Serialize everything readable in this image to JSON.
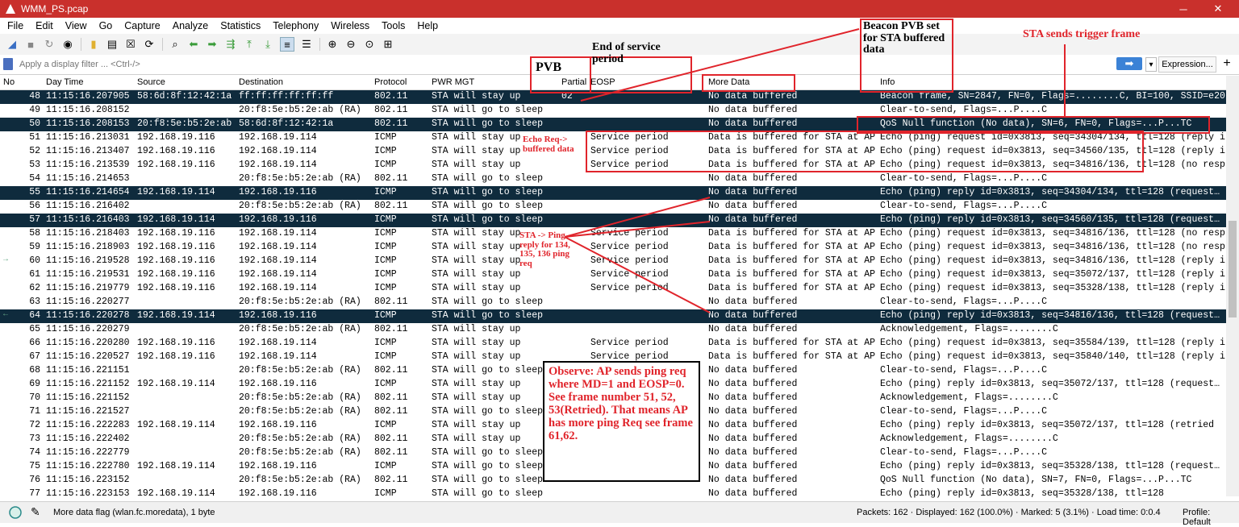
{
  "window": {
    "title": "WMM_PS.pcap"
  },
  "menu": [
    "File",
    "Edit",
    "View",
    "Go",
    "Capture",
    "Analyze",
    "Statistics",
    "Telephony",
    "Wireless",
    "Tools",
    "Help"
  ],
  "filter": {
    "placeholder": "Apply a display filter ... <Ctrl-/>",
    "expression_label": "Expression...",
    "plus": "+"
  },
  "columns": {
    "no": "No",
    "time": "Day Time",
    "source": "Source",
    "destination": "Destination",
    "protocol": "Protocol",
    "pwr": "PWR MGT",
    "partial": "Partial",
    "eosp": "EOSP",
    "more": "More Data",
    "info": "Info"
  },
  "packets": [
    {
      "no": "48",
      "time": "11:15:16.207905",
      "src": "58:6d:8f:12:42:1a",
      "dst": "ff:ff:ff:ff:ff:ff",
      "proto": "802.11",
      "pwr": "STA will stay up",
      "part": "02",
      "eosp": "",
      "more": "No data buffered",
      "info": "Beacon frame, SN=2847, FN=0, Flags=........C, BI=100, SSID=e200…",
      "sel": true
    },
    {
      "no": "49",
      "time": "11:15:16.208152",
      "src": "",
      "dst": "20:f8:5e:b5:2e:ab (RA)",
      "proto": "802.11",
      "pwr": "STA will go to sleep",
      "part": "",
      "eosp": "",
      "more": "No data buffered",
      "info": "Clear-to-send, Flags=...P....C"
    },
    {
      "no": "50",
      "time": "11:15:16.208153",
      "src": "20:f8:5e:b5:2e:ab",
      "dst": "58:6d:8f:12:42:1a",
      "proto": "802.11",
      "pwr": "STA will go to sleep",
      "part": "",
      "eosp": "",
      "more": "No data buffered",
      "info": "QoS Null function (No data), SN=6, FN=0, Flags=...P...TC",
      "sel": true
    },
    {
      "no": "51",
      "time": "11:15:16.213031",
      "src": "192.168.19.116",
      "dst": "192.168.19.114",
      "proto": "ICMP",
      "pwr": "STA will stay up",
      "part": "",
      "eosp": "Service period",
      "more": "Data is buffered for STA at AP",
      "info": "Echo (ping) request  id=0x3813, seq=34304/134, ttl=128 (reply i…"
    },
    {
      "no": "52",
      "time": "11:15:16.213407",
      "src": "192.168.19.116",
      "dst": "192.168.19.114",
      "proto": "ICMP",
      "pwr": "STA will stay up",
      "part": "",
      "eosp": "Service period",
      "more": "Data is buffered for STA at AP",
      "info": "Echo (ping) request  id=0x3813, seq=34560/135, ttl=128 (reply i…"
    },
    {
      "no": "53",
      "time": "11:15:16.213539",
      "src": "192.168.19.116",
      "dst": "192.168.19.114",
      "proto": "ICMP",
      "pwr": "STA will stay up",
      "part": "",
      "eosp": "Service period",
      "more": "Data is buffered for STA at AP",
      "info": "Echo (ping) request  id=0x3813, seq=34816/136, ttl=128 (no resp…"
    },
    {
      "no": "54",
      "time": "11:15:16.214653",
      "src": "",
      "dst": "20:f8:5e:b5:2e:ab (RA)",
      "proto": "802.11",
      "pwr": "STA will go to sleep",
      "part": "",
      "eosp": "",
      "more": "No data buffered",
      "info": "Clear-to-send, Flags=...P....C"
    },
    {
      "no": "55",
      "time": "11:15:16.214654",
      "src": "192.168.19.114",
      "dst": "192.168.19.116",
      "proto": "ICMP",
      "pwr": "STA will go to sleep",
      "part": "",
      "eosp": "",
      "more": "No data buffered",
      "info": "Echo (ping) reply    id=0x3813, seq=34304/134, ttl=128 (request…",
      "sel": true
    },
    {
      "no": "56",
      "time": "11:15:16.216402",
      "src": "",
      "dst": "20:f8:5e:b5:2e:ab (RA)",
      "proto": "802.11",
      "pwr": "STA will go to sleep",
      "part": "",
      "eosp": "",
      "more": "No data buffered",
      "info": "Clear-to-send, Flags=...P....C"
    },
    {
      "no": "57",
      "time": "11:15:16.216403",
      "src": "192.168.19.114",
      "dst": "192.168.19.116",
      "proto": "ICMP",
      "pwr": "STA will go to sleep",
      "part": "",
      "eosp": "",
      "more": "No data buffered",
      "info": "Echo (ping) reply    id=0x3813, seq=34560/135, ttl=128 (request…",
      "sel": true
    },
    {
      "no": "58",
      "time": "11:15:16.218403",
      "src": "192.168.19.116",
      "dst": "192.168.19.114",
      "proto": "ICMP",
      "pwr": "STA will stay up",
      "part": "",
      "eosp": "Service period",
      "more": "Data is buffered for STA at AP",
      "info": "Echo (ping) request  id=0x3813, seq=34816/136, ttl=128 (no resp…"
    },
    {
      "no": "59",
      "time": "11:15:16.218903",
      "src": "192.168.19.116",
      "dst": "192.168.19.114",
      "proto": "ICMP",
      "pwr": "STA will stay up",
      "part": "",
      "eosp": "Service period",
      "more": "Data is buffered for STA at AP",
      "info": "Echo (ping) request  id=0x3813, seq=34816/136, ttl=128 (no resp…"
    },
    {
      "no": "60",
      "time": "11:15:16.219528",
      "src": "192.168.19.116",
      "dst": "192.168.19.114",
      "proto": "ICMP",
      "pwr": "STA will stay up",
      "part": "",
      "eosp": "Service period",
      "more": "Data is buffered for STA at AP",
      "info": "Echo (ping) request  id=0x3813, seq=34816/136, ttl=128 (reply i…",
      "mark": "→"
    },
    {
      "no": "61",
      "time": "11:15:16.219531",
      "src": "192.168.19.116",
      "dst": "192.168.19.114",
      "proto": "ICMP",
      "pwr": "STA will stay up",
      "part": "",
      "eosp": "Service period",
      "more": "Data is buffered for STA at AP",
      "info": "Echo (ping) request  id=0x3813, seq=35072/137, ttl=128 (reply i…"
    },
    {
      "no": "62",
      "time": "11:15:16.219779",
      "src": "192.168.19.116",
      "dst": "192.168.19.114",
      "proto": "ICMP",
      "pwr": "STA will stay up",
      "part": "",
      "eosp": "Service period",
      "more": "Data is buffered for STA at AP",
      "info": "Echo (ping) request  id=0x3813, seq=35328/138, ttl=128 (reply i…"
    },
    {
      "no": "63",
      "time": "11:15:16.220277",
      "src": "",
      "dst": "20:f8:5e:b5:2e:ab (RA)",
      "proto": "802.11",
      "pwr": "STA will go to sleep",
      "part": "",
      "eosp": "",
      "more": "No data buffered",
      "info": "Clear-to-send, Flags=...P....C"
    },
    {
      "no": "64",
      "time": "11:15:16.220278",
      "src": "192.168.19.114",
      "dst": "192.168.19.116",
      "proto": "ICMP",
      "pwr": "STA will go to sleep",
      "part": "",
      "eosp": "",
      "more": "No data buffered",
      "info": "Echo (ping) reply    id=0x3813, seq=34816/136, ttl=128 (request…",
      "sel": true,
      "mark": "←"
    },
    {
      "no": "65",
      "time": "11:15:16.220279",
      "src": "",
      "dst": "20:f8:5e:b5:2e:ab (RA)",
      "proto": "802.11",
      "pwr": "STA will stay up",
      "part": "",
      "eosp": "",
      "more": "No data buffered",
      "info": "Acknowledgement, Flags=........C"
    },
    {
      "no": "66",
      "time": "11:15:16.220280",
      "src": "192.168.19.116",
      "dst": "192.168.19.114",
      "proto": "ICMP",
      "pwr": "STA will stay up",
      "part": "",
      "eosp": "Service period",
      "more": "Data is buffered for STA at AP",
      "info": "Echo (ping) request  id=0x3813, seq=35584/139, ttl=128 (reply i…"
    },
    {
      "no": "67",
      "time": "11:15:16.220527",
      "src": "192.168.19.116",
      "dst": "192.168.19.114",
      "proto": "ICMP",
      "pwr": "STA will stay up",
      "part": "",
      "eosp": "Service period",
      "more": "Data is buffered for STA at AP",
      "info": "Echo (ping) request  id=0x3813, seq=35840/140, ttl=128 (reply i…"
    },
    {
      "no": "68",
      "time": "11:15:16.221151",
      "src": "",
      "dst": "20:f8:5e:b5:2e:ab (RA)",
      "proto": "802.11",
      "pwr": "STA will go to sleep",
      "part": "",
      "eosp": "",
      "more": "No data buffered",
      "info": "Clear-to-send, Flags=...P....C"
    },
    {
      "no": "69",
      "time": "11:15:16.221152",
      "src": "192.168.19.114",
      "dst": "192.168.19.116",
      "proto": "ICMP",
      "pwr": "STA will stay up",
      "part": "",
      "eosp": "",
      "more": "No data buffered",
      "info": "Echo (ping) reply    id=0x3813, seq=35072/137, ttl=128 (request…"
    },
    {
      "no": "70",
      "time": "11:15:16.221152",
      "src": "",
      "dst": "20:f8:5e:b5:2e:ab (RA)",
      "proto": "802.11",
      "pwr": "STA will stay up",
      "part": "",
      "eosp": "",
      "more": "No data buffered",
      "info": "Acknowledgement, Flags=........C"
    },
    {
      "no": "71",
      "time": "11:15:16.221527",
      "src": "",
      "dst": "20:f8:5e:b5:2e:ab (RA)",
      "proto": "802.11",
      "pwr": "STA will go to sleep",
      "part": "",
      "eosp": "",
      "more": "No data buffered",
      "info": "Clear-to-send, Flags=...P....C"
    },
    {
      "no": "72",
      "time": "11:15:16.222283",
      "src": "192.168.19.114",
      "dst": "192.168.19.116",
      "proto": "ICMP",
      "pwr": "STA will stay up",
      "part": "",
      "eosp": "",
      "more": "No data buffered",
      "info": "Echo (ping) reply    id=0x3813, seq=35072/137, ttl=128 (retried"
    },
    {
      "no": "73",
      "time": "11:15:16.222402",
      "src": "",
      "dst": "20:f8:5e:b5:2e:ab (RA)",
      "proto": "802.11",
      "pwr": "STA will stay up",
      "part": "",
      "eosp": "",
      "more": "No data buffered",
      "info": "Acknowledgement, Flags=........C"
    },
    {
      "no": "74",
      "time": "11:15:16.222779",
      "src": "",
      "dst": "20:f8:5e:b5:2e:ab (RA)",
      "proto": "802.11",
      "pwr": "STA will go to sleep",
      "part": "",
      "eosp": "",
      "more": "No data buffered",
      "info": "Clear-to-send, Flags=...P....C"
    },
    {
      "no": "75",
      "time": "11:15:16.222780",
      "src": "192.168.19.114",
      "dst": "192.168.19.116",
      "proto": "ICMP",
      "pwr": "STA will go to sleep",
      "part": "",
      "eosp": "",
      "more": "No data buffered",
      "info": "Echo (ping) reply    id=0x3813, seq=35328/138, ttl=128 (request…"
    },
    {
      "no": "76",
      "time": "11:15:16.223152",
      "src": "",
      "dst": "20:f8:5e:b5:2e:ab (RA)",
      "proto": "802.11",
      "pwr": "STA will go to sleep",
      "part": "",
      "eosp": "",
      "more": "No data buffered",
      "info": "QoS Null function (No data), SN=7, FN=0, Flags=...P...TC"
    },
    {
      "no": "77",
      "time": "11:15:16.223153",
      "src": "192.168.19.114",
      "dst": "192.168.19.116",
      "proto": "ICMP",
      "pwr": "STA will go to sleep",
      "part": "",
      "eosp": "",
      "more": "No data buffered",
      "info": "Echo (ping) reply    id=0x3813, seq=35328/138, ttl=128"
    }
  ],
  "annotations": {
    "pvb": "PVB",
    "end_sp": "End of service period",
    "beacon_pvb": "Beacon PVB set for STA buffered data",
    "trigger": "STA sends trigger frame",
    "echo_req": "Echo Req-> buffered data",
    "sta_reply": "STA -> Ping reply for 134, 135, 136 ping req",
    "observe": "Observe: AP sends ping req where MD=1 and EOSP=0. See frame number 51, 52, 53(Retried). That means AP has more ping Req see frame 61,62."
  },
  "status": {
    "field": "More data flag (wlan.fc.moredata), 1 byte",
    "packets": "Packets: 162 · Displayed: 162 (100.0%) · Marked: 5 (3.1%) · Load time: 0:0.4",
    "profile": "Profile: Default"
  },
  "colors": {
    "titlebar": "#c9302c",
    "selected_row": "#0f2b3d",
    "annotation": "#e0242b"
  }
}
